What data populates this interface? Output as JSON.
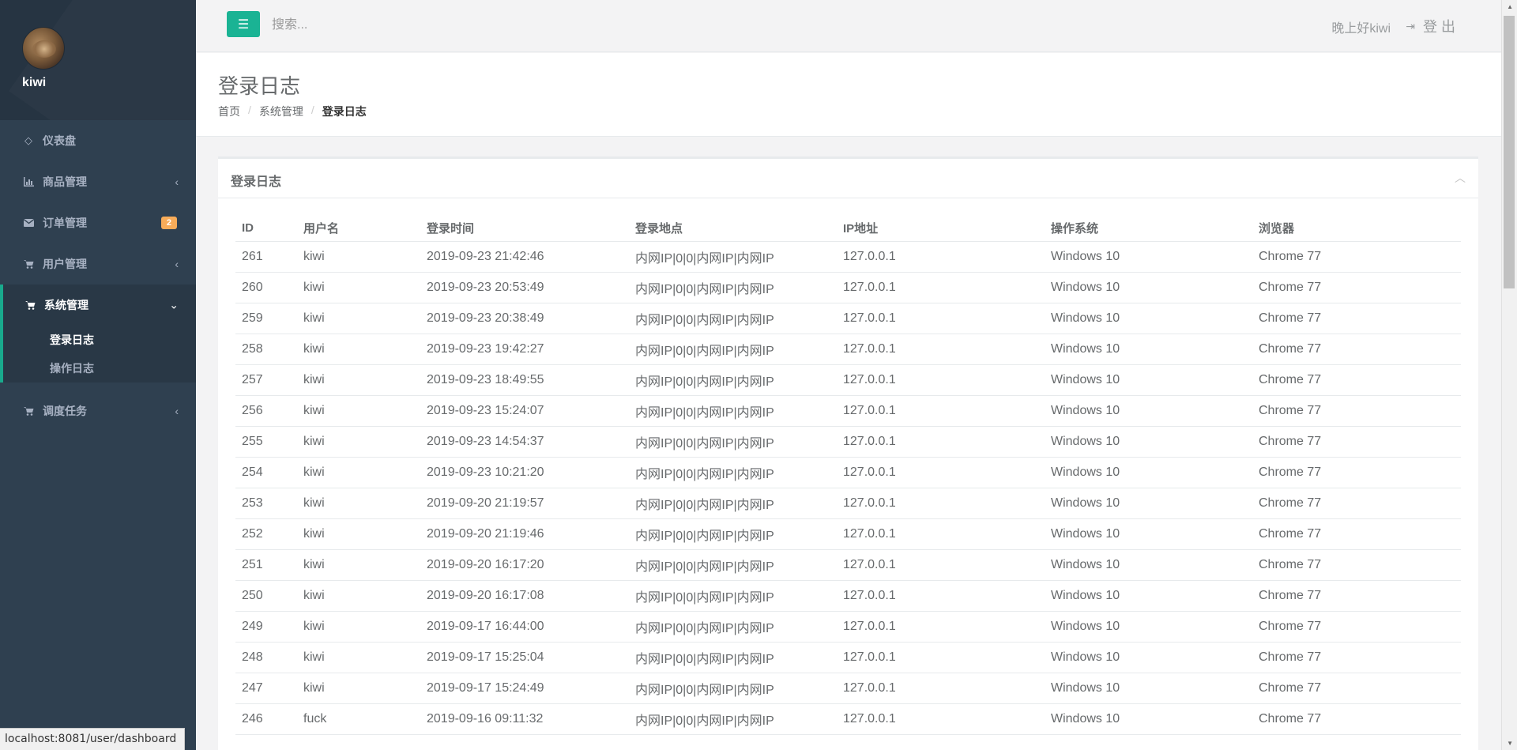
{
  "sidebar": {
    "username": "kiwi",
    "nav": [
      {
        "label": "仪表盘",
        "icon": "diamond-icon"
      },
      {
        "label": "商品管理",
        "icon": "bar-chart-icon"
      },
      {
        "label": "订单管理",
        "icon": "envelope-icon",
        "badge": "2"
      },
      {
        "label": "用户管理",
        "icon": "cart-icon"
      },
      {
        "label": "系统管理",
        "icon": "cart-icon"
      },
      {
        "label": "调度任务",
        "icon": "cart-icon"
      }
    ],
    "system_sub": [
      {
        "label": "登录日志"
      },
      {
        "label": "操作日志"
      }
    ]
  },
  "topbar": {
    "search_placeholder": "搜索...",
    "greeting": "晚上好kiwi",
    "logout_label": "登 出"
  },
  "page": {
    "title": "登录日志",
    "breadcrumb": [
      "首页",
      "系统管理",
      "登录日志"
    ]
  },
  "panel": {
    "title": "登录日志",
    "columns": [
      "ID",
      "用户名",
      "登录时间",
      "登录地点",
      "IP地址",
      "操作系统",
      "浏览器"
    ],
    "rows": [
      [
        "261",
        "kiwi",
        "2019-09-23 21:42:46",
        "内网IP|0|0|内网IP|内网IP",
        "127.0.0.1",
        "Windows 10",
        "Chrome 77"
      ],
      [
        "260",
        "kiwi",
        "2019-09-23 20:53:49",
        "内网IP|0|0|内网IP|内网IP",
        "127.0.0.1",
        "Windows 10",
        "Chrome 77"
      ],
      [
        "259",
        "kiwi",
        "2019-09-23 20:38:49",
        "内网IP|0|0|内网IP|内网IP",
        "127.0.0.1",
        "Windows 10",
        "Chrome 77"
      ],
      [
        "258",
        "kiwi",
        "2019-09-23 19:42:27",
        "内网IP|0|0|内网IP|内网IP",
        "127.0.0.1",
        "Windows 10",
        "Chrome 77"
      ],
      [
        "257",
        "kiwi",
        "2019-09-23 18:49:55",
        "内网IP|0|0|内网IP|内网IP",
        "127.0.0.1",
        "Windows 10",
        "Chrome 77"
      ],
      [
        "256",
        "kiwi",
        "2019-09-23 15:24:07",
        "内网IP|0|0|内网IP|内网IP",
        "127.0.0.1",
        "Windows 10",
        "Chrome 77"
      ],
      [
        "255",
        "kiwi",
        "2019-09-23 14:54:37",
        "内网IP|0|0|内网IP|内网IP",
        "127.0.0.1",
        "Windows 10",
        "Chrome 77"
      ],
      [
        "254",
        "kiwi",
        "2019-09-23 10:21:20",
        "内网IP|0|0|内网IP|内网IP",
        "127.0.0.1",
        "Windows 10",
        "Chrome 77"
      ],
      [
        "253",
        "kiwi",
        "2019-09-20 21:19:57",
        "内网IP|0|0|内网IP|内网IP",
        "127.0.0.1",
        "Windows 10",
        "Chrome 77"
      ],
      [
        "252",
        "kiwi",
        "2019-09-20 21:19:46",
        "内网IP|0|0|内网IP|内网IP",
        "127.0.0.1",
        "Windows 10",
        "Chrome 77"
      ],
      [
        "251",
        "kiwi",
        "2019-09-20 16:17:20",
        "内网IP|0|0|内网IP|内网IP",
        "127.0.0.1",
        "Windows 10",
        "Chrome 77"
      ],
      [
        "250",
        "kiwi",
        "2019-09-20 16:17:08",
        "内网IP|0|0|内网IP|内网IP",
        "127.0.0.1",
        "Windows 10",
        "Chrome 77"
      ],
      [
        "249",
        "kiwi",
        "2019-09-17 16:44:00",
        "内网IP|0|0|内网IP|内网IP",
        "127.0.0.1",
        "Windows 10",
        "Chrome 77"
      ],
      [
        "248",
        "kiwi",
        "2019-09-17 15:25:04",
        "内网IP|0|0|内网IP|内网IP",
        "127.0.0.1",
        "Windows 10",
        "Chrome 77"
      ],
      [
        "247",
        "kiwi",
        "2019-09-17 15:24:49",
        "内网IP|0|0|内网IP|内网IP",
        "127.0.0.1",
        "Windows 10",
        "Chrome 77"
      ],
      [
        "246",
        "fuck",
        "2019-09-16 09:11:32",
        "内网IP|0|0|内网IP|内网IP",
        "127.0.0.1",
        "Windows 10",
        "Chrome 77"
      ]
    ]
  },
  "statusbar": {
    "url": "localhost:8081/user/dashboard"
  },
  "colors": {
    "sidebar_bg": "#2f4050",
    "accent": "#1ab394",
    "badge": "#f8ac59"
  }
}
